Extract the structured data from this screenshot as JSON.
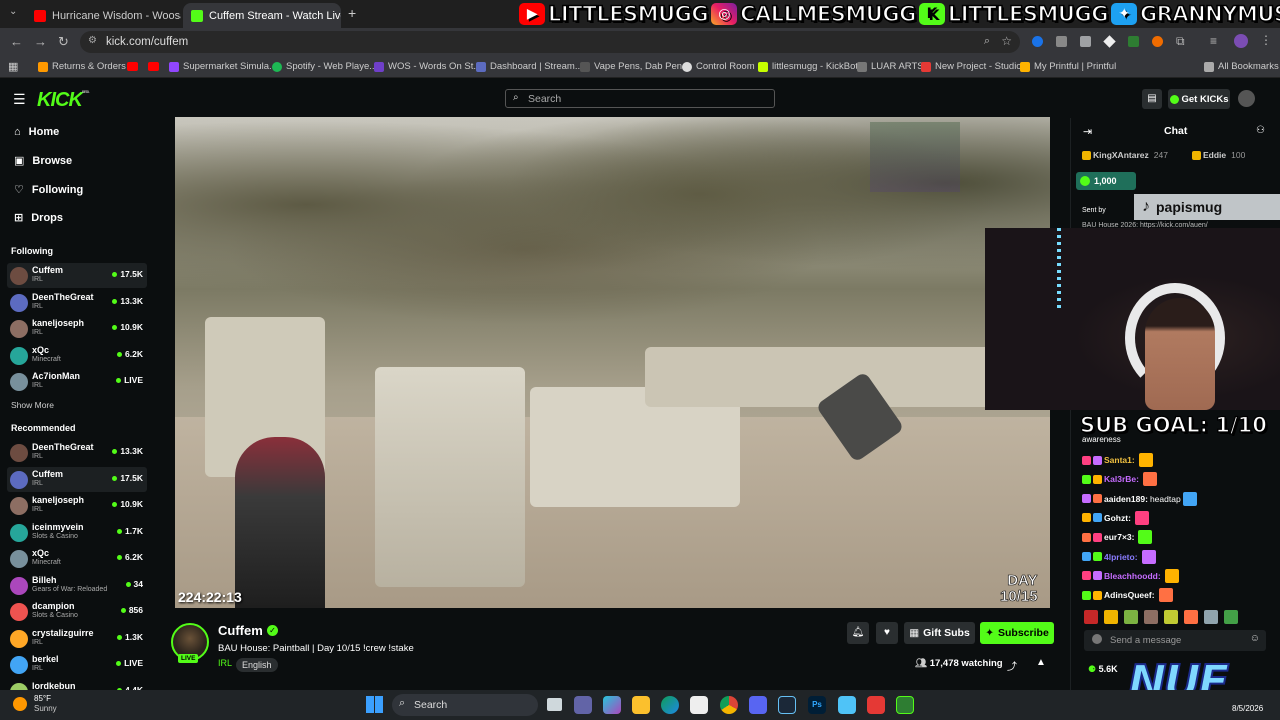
{
  "browser": {
    "tabs": [
      {
        "title": "Hurricane Wisdom - Woosah (O",
        "active": false
      },
      {
        "title": "Cuffem Stream - Watch Live on",
        "active": true
      }
    ],
    "url": "kick.com/cuffem",
    "bookmarks": [
      "Returns & Orders",
      "Supermarket Simula...",
      "Spotify - Web Playe...",
      "WOS - Words On St...",
      "Dashboard | Stream...",
      "Vape Pens, Dab Pen...",
      "Control Room",
      "littlesmugg - KickBot",
      "LUAR ARTS",
      "New Project - Studio",
      "My Printful | Printful",
      "All Bookmarks"
    ]
  },
  "social_overlay": [
    "LITTLESMUGG",
    "CALLMESMUGG",
    "LITTLESMUGG",
    "GRANNYMUSLIM"
  ],
  "topbar": {
    "logo": "KICK",
    "logo_sup": "BETA",
    "search_placeholder": "Search",
    "get_kicks": "Get KICKs"
  },
  "sidebar": {
    "nav": [
      "Home",
      "Browse",
      "Following",
      "Drops"
    ],
    "following_heading": "Following",
    "following": [
      {
        "name": "Cuffem",
        "category": "IRL",
        "viewers": "17.5K"
      },
      {
        "name": "DeenTheGreat",
        "category": "IRL",
        "viewers": "13.3K"
      },
      {
        "name": "kaneljoseph",
        "category": "IRL",
        "viewers": "10.9K"
      },
      {
        "name": "xQc",
        "category": "Minecraft",
        "viewers": "6.2K"
      },
      {
        "name": "Ac7ionMan",
        "category": "IRL",
        "viewers": "LIVE"
      }
    ],
    "show_more": "Show More",
    "recommended_heading": "Recommended",
    "recommended": [
      {
        "name": "DeenTheGreat",
        "category": "IRL",
        "viewers": "13.3K"
      },
      {
        "name": "Cuffem",
        "category": "IRL",
        "viewers": "17.5K"
      },
      {
        "name": "kaneljoseph",
        "category": "IRL",
        "viewers": "10.9K"
      },
      {
        "name": "iceinmyvein",
        "category": "Slots & Casino",
        "viewers": "1.7K"
      },
      {
        "name": "xQc",
        "category": "Minecraft",
        "viewers": "6.2K"
      },
      {
        "name": "Billeh",
        "category": "Gears of War: Reloaded",
        "viewers": "34"
      },
      {
        "name": "dcampion",
        "category": "Slots & Casino",
        "viewers": "856"
      },
      {
        "name": "crystalizguirre",
        "category": "IRL",
        "viewers": "1.3K"
      },
      {
        "name": "berkel",
        "category": "IRL",
        "viewers": "LIVE"
      },
      {
        "name": "lordkebun",
        "category": "",
        "viewers": "4.4K"
      }
    ]
  },
  "player": {
    "timestamp": "224:22:13",
    "day_overlay_1": "DAY",
    "day_overlay_2": "10/15"
  },
  "stream": {
    "streamer": "Cuffem",
    "live_badge": "LIVE",
    "title": "BAU House: Paintball | Day 10/15  !crew !stake",
    "category": "IRL",
    "language": "English",
    "gift_subs": "Gift Subs",
    "subscribe": "Subscribe",
    "watching": "17,478 watching"
  },
  "chat": {
    "title": "Chat",
    "leaders": [
      {
        "name": "KingXAntarez",
        "value": "247"
      },
      {
        "name": "Eddie",
        "value": "100"
      }
    ],
    "kicks_pill": "1,000",
    "sent_by": "Sent by",
    "pinned": "BAU House 2026: https://kick.com/auen/",
    "tiktok_handle": "papismug",
    "sub_goal": "SUB GOAL: 1/10",
    "awareness": "awareness",
    "messages": [
      {
        "user": "Santa1:",
        "text": "",
        "color": "#f0c040"
      },
      {
        "user": "Kal3rBe:",
        "text": "",
        "color": "#c66cff"
      },
      {
        "user": "aaiden189:",
        "text": "headtap",
        "color": "#ffffff"
      },
      {
        "user": "Gohzt:",
        "text": "",
        "color": "#ffffff"
      },
      {
        "user": "eur7×3:",
        "text": "",
        "color": "#ffffff"
      },
      {
        "user": "4lprieto:",
        "text": "",
        "color": "#8a7cff"
      },
      {
        "user": "Bleachhoodd:",
        "text": "",
        "color": "#c66cff"
      },
      {
        "user": "AdinsQueef:",
        "text": "",
        "color": "#ffffff"
      }
    ],
    "send_placeholder": "Send a message",
    "kicks_balance": "5.6K"
  },
  "nue_logo": "NUE",
  "taskbar": {
    "temperature": "85°F",
    "weather": "Sunny",
    "search": "Search",
    "date": "8/5/2026"
  }
}
